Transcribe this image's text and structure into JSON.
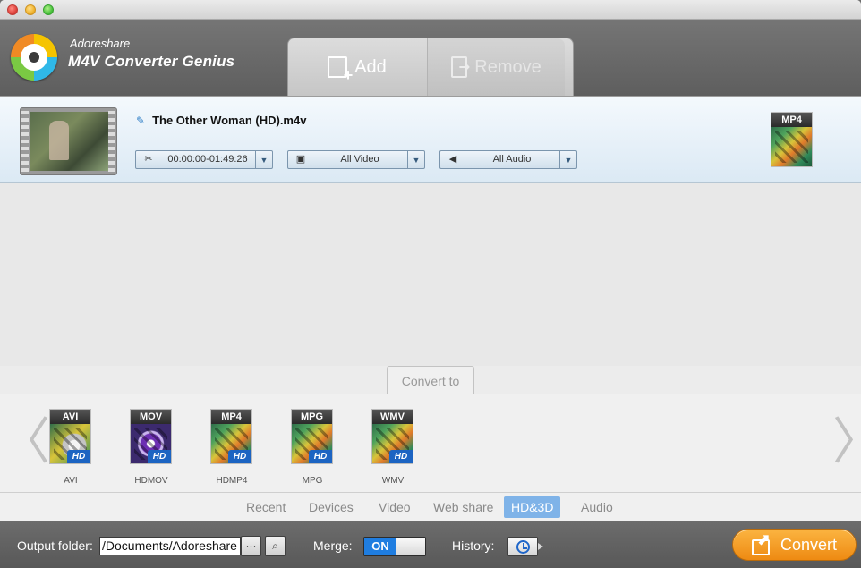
{
  "app": {
    "brand_small": "Adoreshare",
    "brand_big": "M4V Converter Genius"
  },
  "toolbar": {
    "add_label": "Add",
    "remove_label": "Remove"
  },
  "file": {
    "name": "The Other Woman (HD).m4v",
    "time_range": "00:00:00-01:49:26",
    "video_track": "All Video",
    "audio_track": "All Audio",
    "output_format": "MP4"
  },
  "convert_to": {
    "tab_label": "Convert to",
    "formats": [
      {
        "badge": "AVI",
        "caption": "AVI",
        "hd": "HD"
      },
      {
        "badge": "MOV",
        "caption": "HDMOV",
        "hd": "HD"
      },
      {
        "badge": "MP4",
        "caption": "HDMP4",
        "hd": "HD"
      },
      {
        "badge": "MPG",
        "caption": "MPG",
        "hd": "HD"
      },
      {
        "badge": "WMV",
        "caption": "WMV",
        "hd": "HD"
      }
    ],
    "categories": [
      "Recent",
      "Devices",
      "Video",
      "Web share",
      "HD&3D",
      "Audio"
    ],
    "active_category": "HD&3D"
  },
  "bottom": {
    "output_label": "Output folder:",
    "output_value": "/Documents/Adoreshare",
    "browse_label": "···",
    "merge_label": "Merge:",
    "merge_state": "ON",
    "history_label": "History:",
    "convert_label": "Convert"
  },
  "colors": {
    "accent": "#1f7de0",
    "convert_button": "#f39a1f",
    "active_category": "#7fb3e8"
  },
  "icons": {
    "prev": "chevron-left-icon",
    "next": "chevron-right-icon",
    "search": "search-icon",
    "history": "clock-icon"
  }
}
